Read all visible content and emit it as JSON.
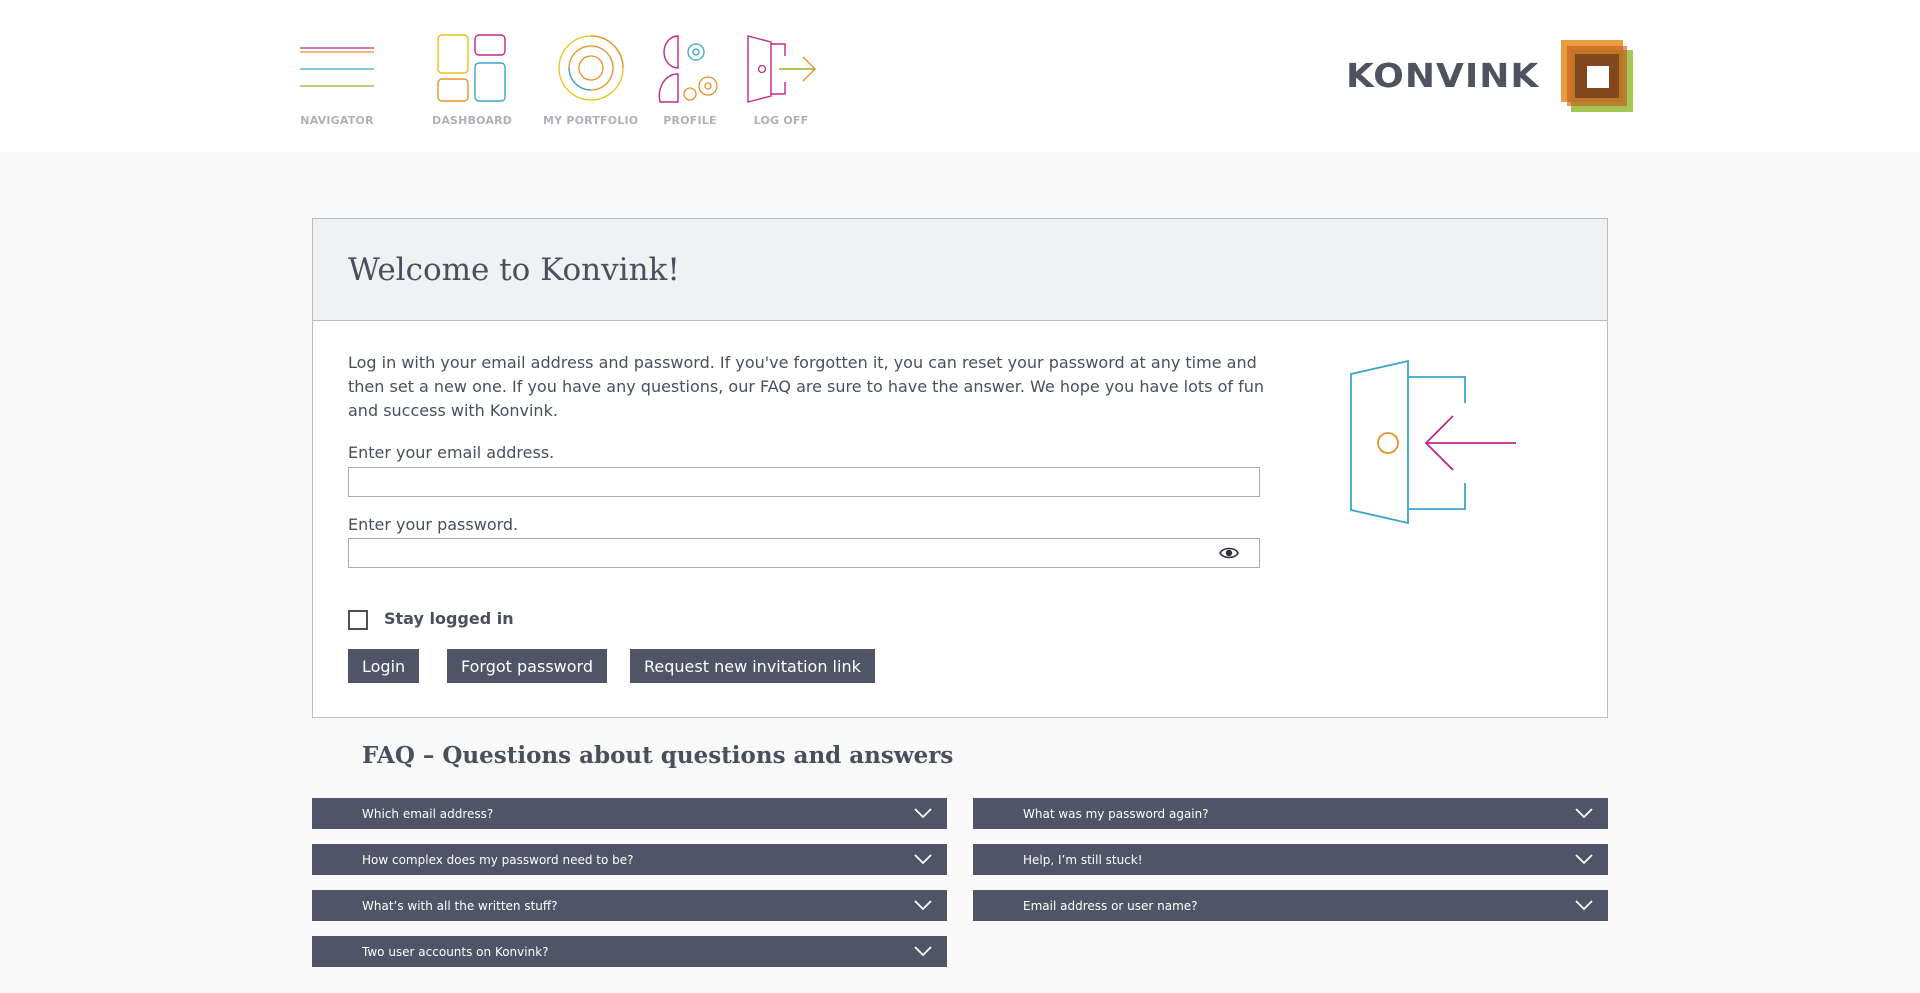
{
  "nav": {
    "items": [
      {
        "label": "NAVIGATOR",
        "icon": "hamburger-icon"
      },
      {
        "label": "DASHBOARD",
        "icon": "dashboard-icon"
      },
      {
        "label": "MY PORTFOLIO",
        "icon": "portfolio-icon"
      },
      {
        "label": "PROFILE",
        "icon": "profile-icon"
      },
      {
        "label": "LOG OFF",
        "icon": "logoff-icon"
      }
    ]
  },
  "brand": {
    "name": "KONVINK"
  },
  "colors": {
    "accent_dark": "#4f5466",
    "orange": "#e8922a",
    "magenta": "#c2268f",
    "cyan": "#3aa6c9",
    "green": "#8fb62b",
    "brown": "#7a3d1c"
  },
  "login": {
    "title": "Welcome to Konvink!",
    "intro": "Log in with your email address and password. If you've forgotten it, you can reset your password at any time and then set a new one. If you have any questions, our FAQ are sure to have the answer. We hope you have lots of fun and success with Konvink.",
    "email_label": "Enter your email address.",
    "email_value": "",
    "password_label": "Enter your password.",
    "password_value": "",
    "stay_logged_in": "Stay logged in",
    "buttons": {
      "login": "Login",
      "forgot": "Forgot password",
      "invite": "Request new invitation link"
    }
  },
  "faq": {
    "title": "FAQ – Questions about questions and answers",
    "left": [
      "Which email address?",
      "How complex does my password need to be?",
      "What’s with all the written stuff?",
      "Two user accounts on Konvink?"
    ],
    "right": [
      "What was my password again?",
      "Help, I’m still stuck!",
      "Email address or user name?"
    ]
  }
}
